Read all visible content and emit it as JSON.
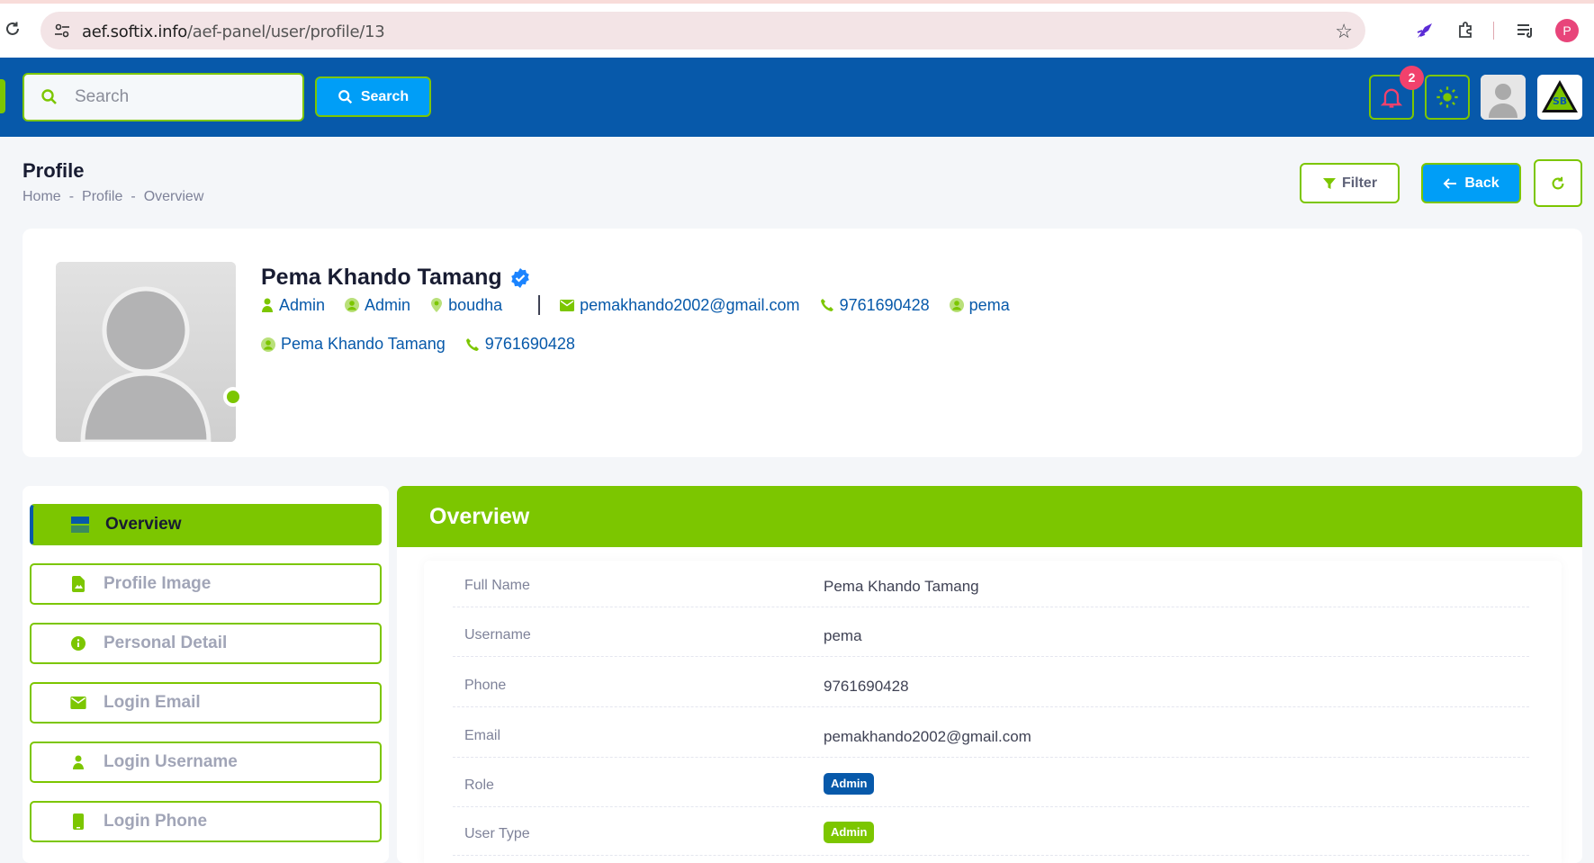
{
  "browser": {
    "url_host": "aef.softix.info",
    "url_path": "/aef-panel/user/profile/13",
    "profile_initial": "P"
  },
  "header": {
    "search_placeholder": "Search",
    "search_button": "Search",
    "notification_count": "2",
    "accent_color": "#7cc600",
    "brand_color": "#0759aa"
  },
  "toolbar": {
    "title": "Profile",
    "breadcrumb": [
      "Home",
      "Profile",
      "Overview"
    ],
    "breadcrumb_sep": "-",
    "filter_label": "Filter",
    "back_label": "Back"
  },
  "profile": {
    "name": "Pema Khando Tamang",
    "verified": true,
    "role": "Admin",
    "user_type": "Admin",
    "address": "boudha",
    "email": "pemakhando2002@gmail.com",
    "phone": "9761690428",
    "username": "pema",
    "full_name": "Pema Khando Tamang",
    "phone2": "9761690428"
  },
  "sidenav": {
    "items": [
      {
        "label": "Overview",
        "icon": "overview-icon",
        "active": true
      },
      {
        "label": "Profile Image",
        "icon": "file-image-icon",
        "active": false
      },
      {
        "label": "Personal Detail",
        "icon": "info-icon",
        "active": false
      },
      {
        "label": "Login Email",
        "icon": "envelope-icon",
        "active": false
      },
      {
        "label": "Login Username",
        "icon": "user-icon",
        "active": false
      },
      {
        "label": "Login Phone",
        "icon": "phone-icon",
        "active": false
      }
    ]
  },
  "overview": {
    "title": "Overview",
    "rows": [
      {
        "label": "Full Name",
        "value": "Pema Khando Tamang"
      },
      {
        "label": "Username",
        "value": "pema"
      },
      {
        "label": "Phone",
        "value": "9761690428"
      },
      {
        "label": "Email",
        "value": "pemakhando2002@gmail.com"
      },
      {
        "label": "Role",
        "value": "Admin"
      },
      {
        "label": "User Type",
        "value": "Admin"
      }
    ]
  }
}
